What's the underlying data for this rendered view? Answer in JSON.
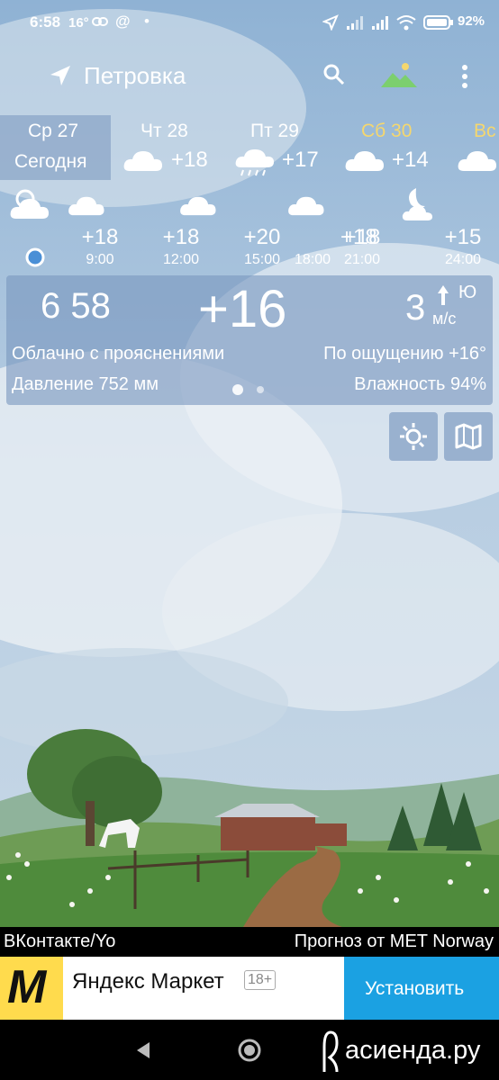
{
  "status_bar": {
    "time": "6:58",
    "temperature": "16°",
    "at_sign": "@",
    "dot": "•",
    "battery": "92%"
  },
  "app_bar": {
    "location": "Петровка"
  },
  "days": [
    {
      "name": "Ср 27",
      "sub": "Сегодня",
      "color": "#ffffff"
    },
    {
      "name": "Чт 28",
      "temp": "+18",
      "color": "#ffffff"
    },
    {
      "name": "Пт 29",
      "temp": "+17",
      "color": "#ffffff"
    },
    {
      "name": "Сб 30",
      "temp": "+14",
      "color": "#f5d76e"
    },
    {
      "name": "Вс",
      "color": "#f5d76e"
    }
  ],
  "hourly": [
    {
      "temp": "+18",
      "time": "9:00"
    },
    {
      "temp": "+18",
      "time": "12:00"
    },
    {
      "temp": "+20",
      "time": "15:00"
    },
    {
      "temp": "+18",
      "time": "18:00"
    },
    {
      "temp": "+18",
      "time": "21:00"
    },
    {
      "temp": "+15",
      "time": "24:00"
    }
  ],
  "current": {
    "time_left": "6 58",
    "temperature": "+16",
    "wind_speed": "3",
    "wind_unit": "м/с",
    "wind_dir": "Ю",
    "condition": "Облачно с прояснениями",
    "feels_like": "По ощущению +16°",
    "pressure": "Давление 752 мм",
    "humidity": "Влажность 94%"
  },
  "source_bar": {
    "left": "ВКонтакте/Yo",
    "right": "Прогноз от MET Norway"
  },
  "ad": {
    "logo_letter": "M",
    "title": "Яндекс Маркет",
    "age": "18+",
    "install": "Установить"
  },
  "watermark": "асиенда.ру",
  "colors": {
    "accent_yellow": "#f5d76e",
    "panel": "#7896be",
    "ad_button": "#1ba1e2"
  }
}
